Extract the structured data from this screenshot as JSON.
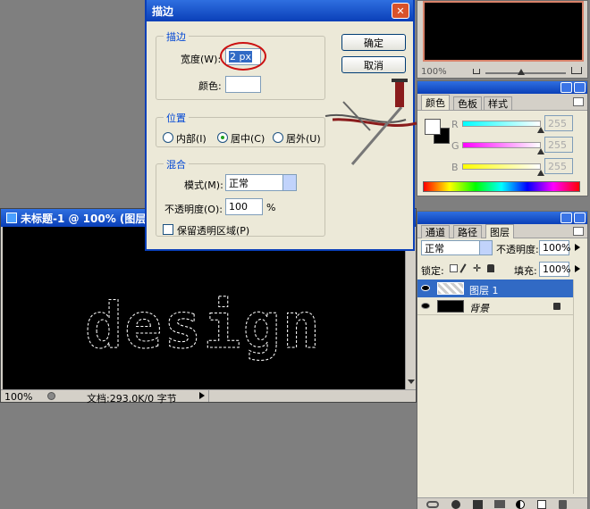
{
  "stroke_dialog": {
    "title": "描边",
    "ok_label": "确定",
    "cancel_label": "取消",
    "stroke_group": "描边",
    "width_label": "宽度(W):",
    "width_value": "2 px",
    "color_label": "颜色:",
    "location_group": "位置",
    "inside_label": "内部(I)",
    "center_label": "居中(C)",
    "outside_label": "居外(U)",
    "location_selected": "center",
    "blend_group": "混合",
    "mode_label": "模式(M):",
    "mode_value": "正常",
    "opacity_label": "不透明度(O):",
    "opacity_value": "100",
    "opacity_unit": "%",
    "preserve_label": "保留透明区域(P)",
    "preserve_checked": false
  },
  "document": {
    "title": "未标题-1 @ 100% (图层",
    "zoom": "100%",
    "status": "文档:293.0K/0 字节",
    "canvas_text": "design"
  },
  "navigator": {
    "zoom": "100%"
  },
  "color_panel": {
    "tabs": [
      "颜色",
      "色板",
      "样式"
    ],
    "active_tab": 0,
    "channels": [
      {
        "label": "R",
        "value": "255"
      },
      {
        "label": "G",
        "value": "255"
      },
      {
        "label": "B",
        "value": "255"
      }
    ]
  },
  "layers_panel": {
    "tabs": [
      "通道",
      "路径",
      "图层"
    ],
    "active_tab": 2,
    "blend_mode": "正常",
    "opacity_label": "不透明度:",
    "opacity_value": "100%",
    "lock_label": "锁定:",
    "fill_label": "填充:",
    "fill_value": "100%",
    "layers": [
      {
        "name": "图层 1",
        "selected": true
      },
      {
        "name": "背景",
        "selected": false,
        "locked": true
      }
    ]
  },
  "colors": {
    "xp_blue": "#0a3fb8",
    "dialog_bg": "#ece9d8",
    "canvas_bg": "#000000",
    "annotation_red": "#cc1111",
    "selection_blue": "#316ac5"
  }
}
